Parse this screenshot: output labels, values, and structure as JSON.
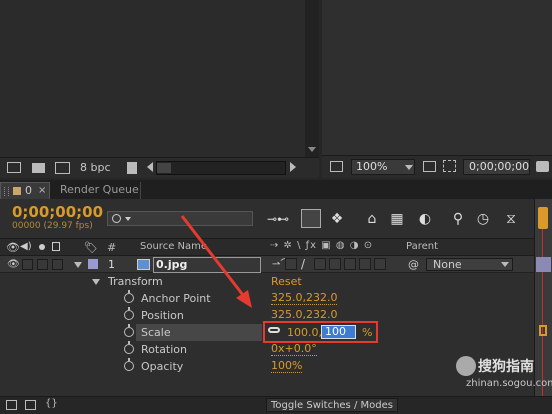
{
  "project_panel": {
    "bpc_label": "8 bpc"
  },
  "composition_viewer": {
    "zoom": "100%",
    "timecode": "0;00;00;00"
  },
  "tabs": [
    {
      "label": "0",
      "active": true
    },
    {
      "label": "Render Queue",
      "active": false
    }
  ],
  "timeline": {
    "current_time": "0;00;00;00",
    "frame_info": "00000 (29.97 fps)",
    "search_placeholder": "",
    "headers": {
      "hash": "#",
      "source_name": "Source Name",
      "parent": "Parent"
    },
    "layer": {
      "number": "1",
      "name": "0.jpg",
      "parent_value": "None"
    },
    "transform": {
      "label": "Transform",
      "reset": "Reset"
    },
    "properties": [
      {
        "name": "Anchor Point",
        "value": "325.0,232.0"
      },
      {
        "name": "Position",
        "value": "325.0,232.0"
      },
      {
        "name": "Scale",
        "value_x": "100.0,",
        "value_y_edit": "100",
        "unit": "%"
      },
      {
        "name": "Rotation",
        "value": "0x+0.0°"
      },
      {
        "name": "Opacity",
        "value": "100%"
      }
    ],
    "footer_toggle": "Toggle Switches / Modes"
  },
  "watermark": {
    "text_cn": "搜狗指南",
    "url": "zhinan.sogou.com"
  },
  "colors": {
    "accent_orange": "#d99a2b",
    "highlight_red": "#e53a2f",
    "edit_blue": "#3d7bd4"
  }
}
